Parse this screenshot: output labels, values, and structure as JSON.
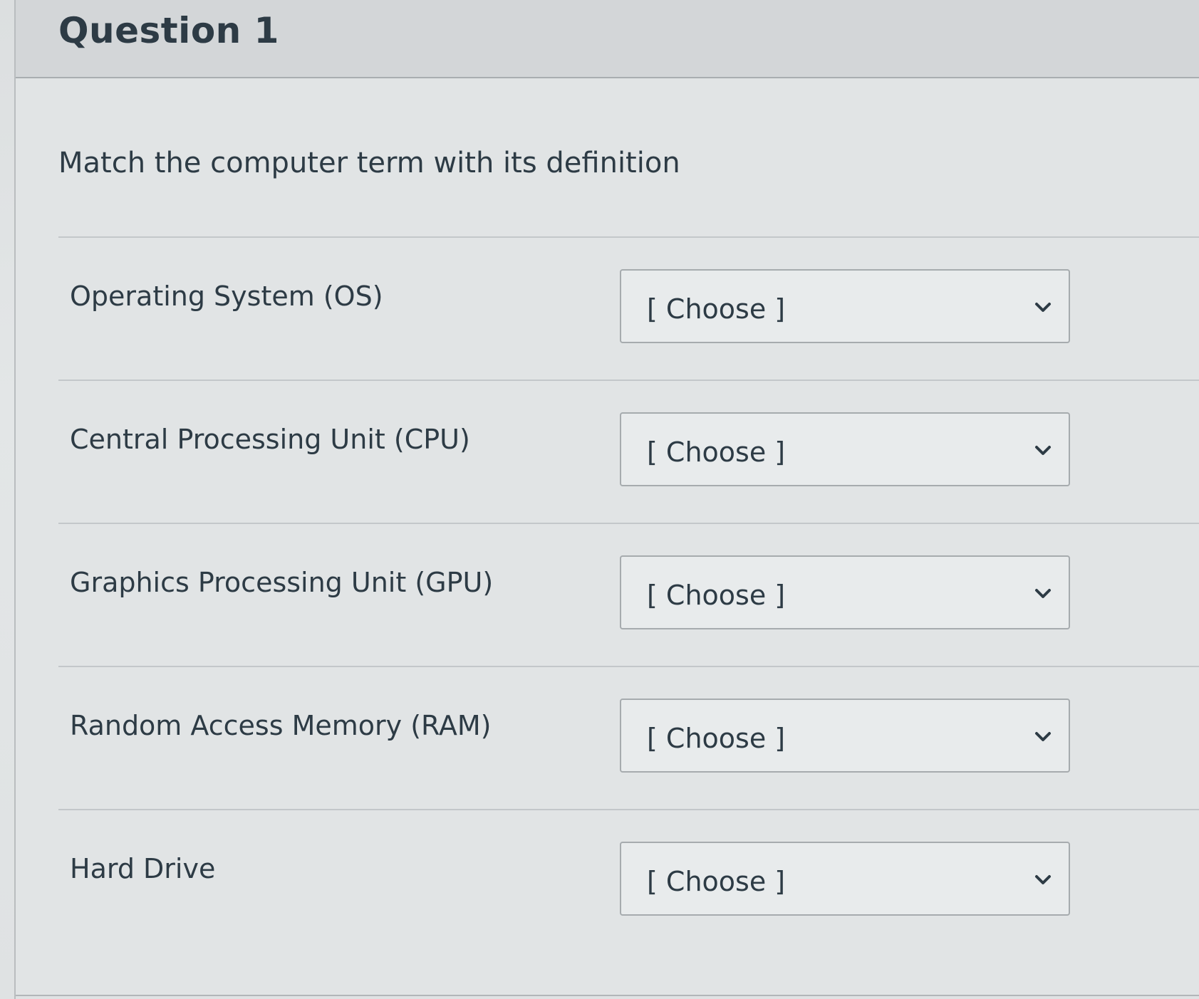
{
  "question": {
    "title": "Question 1",
    "prompt": "Match the computer term with its definition"
  },
  "rows": [
    {
      "term": "Operating System (OS)",
      "selected": "[ Choose ]"
    },
    {
      "term": "Central Processing Unit (CPU)",
      "selected": "[ Choose ]"
    },
    {
      "term": "Graphics Processing Unit (GPU)",
      "selected": "[ Choose ]"
    },
    {
      "term": "Random Access Memory (RAM)",
      "selected": "[ Choose ]"
    },
    {
      "term": "Hard Drive",
      "selected": "[ Choose ]"
    }
  ],
  "icons": {
    "dropdown": "chevron-down-icon"
  },
  "colors": {
    "text": "#2d3b45",
    "border": "#a6abae",
    "background": "#e1e4e5"
  }
}
